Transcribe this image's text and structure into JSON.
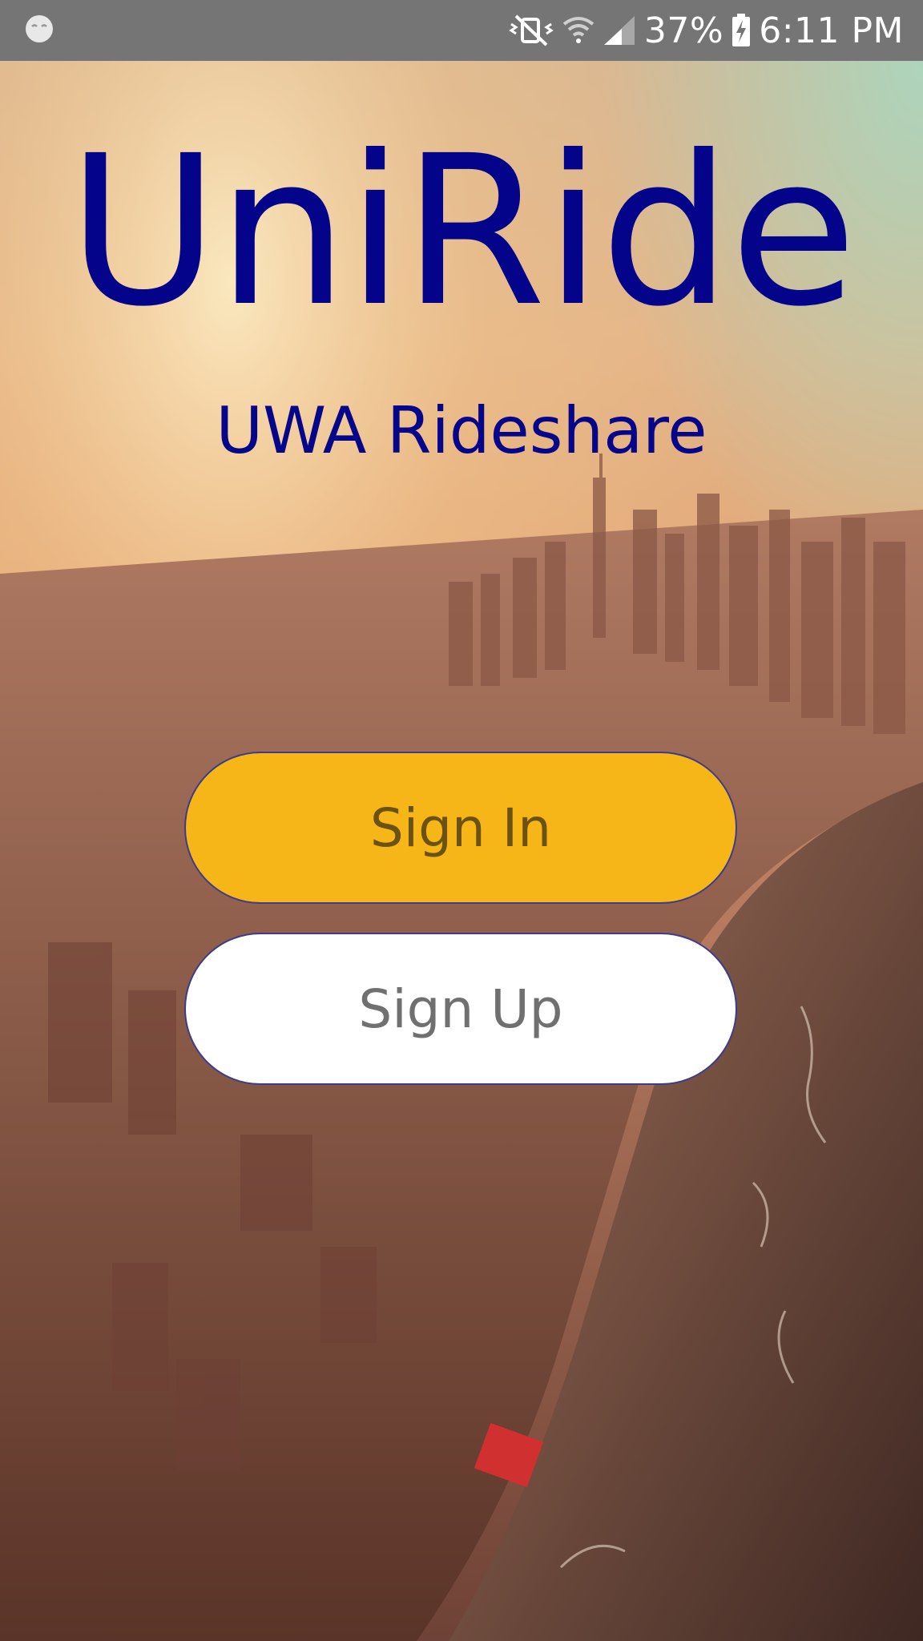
{
  "status_bar": {
    "battery": "37%",
    "time": "6:11 PM",
    "icons": [
      "notification-face-icon",
      "mute-vibrate-icon",
      "wifi-icon",
      "signal-icon",
      "battery-charging-icon"
    ]
  },
  "app": {
    "title": "UniRide",
    "subtitle": "UWA Rideshare"
  },
  "buttons": {
    "sign_in": "Sign In",
    "sign_up": "Sign Up"
  },
  "colors": {
    "title": "#04048a",
    "sign_in_bg": "#f7b617",
    "sign_up_bg": "#ffffff",
    "status_bar": "#757575"
  }
}
